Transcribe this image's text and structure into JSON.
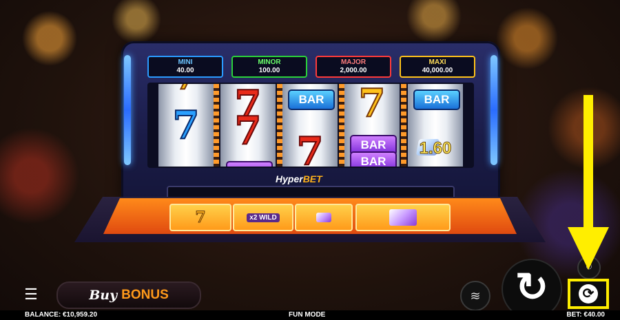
{
  "jackpots": [
    {
      "name": "MINI",
      "value": "40.00"
    },
    {
      "name": "MINOR",
      "value": "100.00"
    },
    {
      "name": "MAJOR",
      "value": "2,000.00"
    },
    {
      "name": "MAXI",
      "value": "40,000.00"
    }
  ],
  "reels": {
    "bar_label": "BAR",
    "multiplier": "1.60"
  },
  "logo": {
    "part1": "Hyper",
    "part2": "BET"
  },
  "tray": {
    "wild_label": "x2 WILD"
  },
  "controls": {
    "buy_label_1": "Buy",
    "buy_label_2": "BONUS"
  },
  "status": {
    "balance": "BALANCE: €10,959.20",
    "mode": "FUN MODE",
    "bet": "BET: €40.00"
  },
  "colors": {
    "highlight": "#ffee00",
    "accent": "#ff9a1a"
  }
}
